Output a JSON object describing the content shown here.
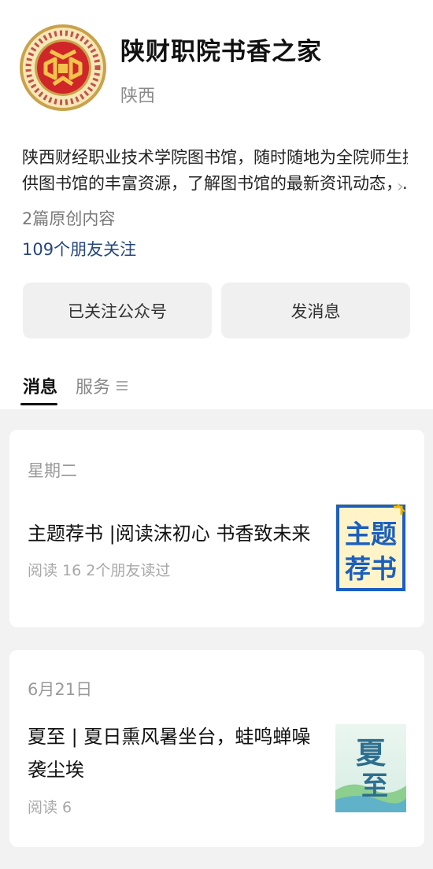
{
  "account": {
    "name": "陕财职院书香之家",
    "region": "陕西",
    "description_line1": "陕西财经职业技术学院图书馆，随时随地为全院师生提",
    "description_line2": "供图书馆的丰富资源，了解图书馆的最新资讯动态，...",
    "original_count": "2篇原创内容",
    "followers": "109个朋友关注"
  },
  "buttons": {
    "followed": "已关注公众号",
    "message": "发消息"
  },
  "tabs": {
    "messages": "消息",
    "services": "服务"
  },
  "articles": [
    {
      "date": "星期二",
      "title": "主题荐书 |阅读沫初心 书香致未来",
      "meta": "阅读 16   2个朋友读过",
      "thumb_text_top": "主题",
      "thumb_text_bottom": "荐书"
    },
    {
      "date": "6月21日",
      "title": "夏至 | 夏日熏风暑坐台，蛙鸣蝉噪袭尘埃",
      "meta": "阅读 6",
      "thumb_text_top": "夏",
      "thumb_text_bottom": "至"
    }
  ],
  "colors": {
    "follower_link": "#26467f",
    "logo_gold": "#c9a24a",
    "logo_red": "#d0262a",
    "thumb1_blue": "#1b5fbf",
    "thumb1_bg": "#fff4c8"
  }
}
